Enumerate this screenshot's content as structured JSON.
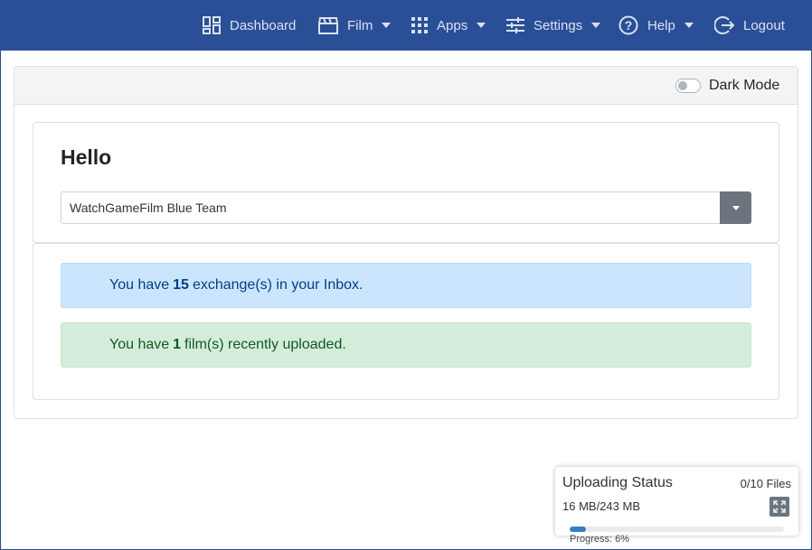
{
  "nav": {
    "dashboard": "Dashboard",
    "film": "Film",
    "apps": "Apps",
    "settings": "Settings",
    "help": "Help",
    "logout": "Logout",
    "icons": [
      "dashboard-icon",
      "film-icon",
      "apps-grid-icon",
      "settings-sliders-icon",
      "help-icon",
      "logout-icon"
    ]
  },
  "header": {
    "dark_mode_label": "Dark Mode",
    "dark_mode_on": false
  },
  "hello": {
    "title": "Hello",
    "team_selected": "WatchGameFilm Blue Team"
  },
  "alerts": {
    "inbox_prefix": "You have",
    "inbox_count": "15",
    "inbox_suffix": "exchange(s) in your Inbox.",
    "film_prefix": "You have",
    "film_count": "1",
    "film_suffix": "film(s) recently uploaded."
  },
  "upload": {
    "title": "Uploading Status",
    "files": "0/10 Files",
    "size": "16 MB/243 MB",
    "progress_label": "Progress: 6%",
    "progress_fraction": 0.06
  },
  "colors": {
    "navbar": "#2a4f96",
    "info": "#cce5ff",
    "success": "#d4edda",
    "progress": "#3a7bbf"
  }
}
